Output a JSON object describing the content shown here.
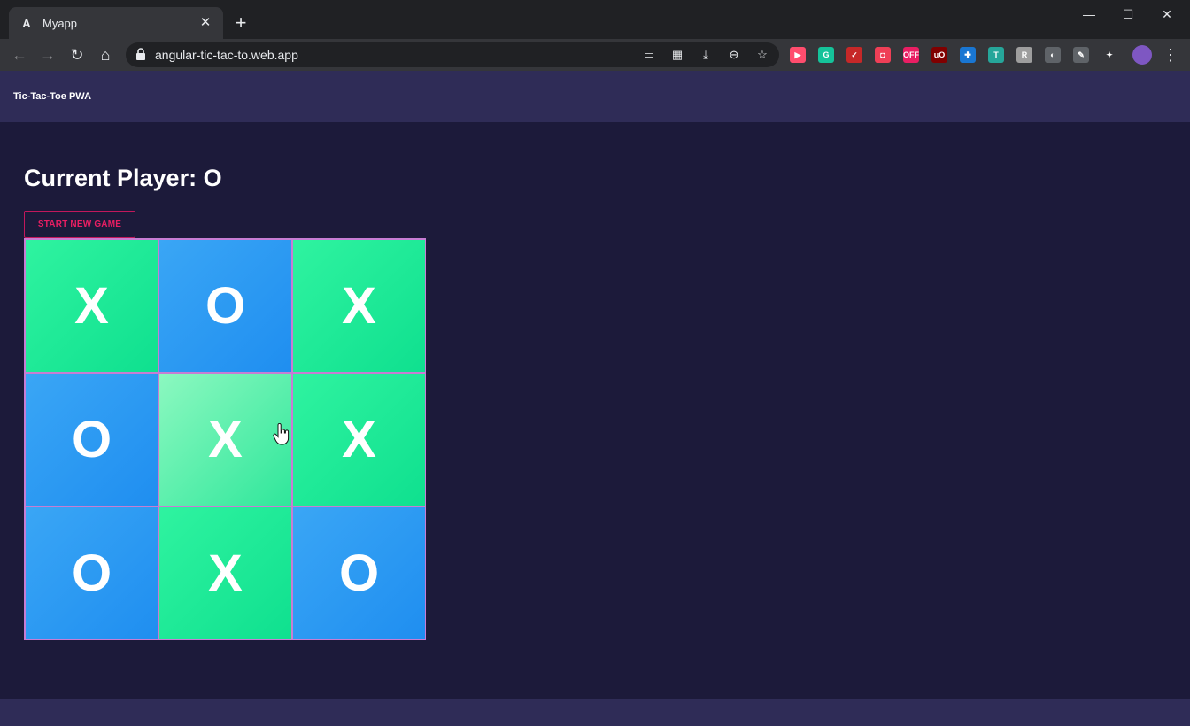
{
  "browser": {
    "tab_title": "Myapp",
    "tab_favicon": "A",
    "url": "angular-tic-tac-to.web.app",
    "extensions": [
      {
        "name": "video-ext-icon",
        "color": "#ff4d6d",
        "glyph": "▶"
      },
      {
        "name": "grammarly-icon",
        "color": "#15c39a",
        "glyph": "G"
      },
      {
        "name": "ext-red-icon",
        "color": "#c62828",
        "glyph": "✓"
      },
      {
        "name": "pocket-icon",
        "color": "#ef3f56",
        "glyph": "◘"
      },
      {
        "name": "off-ext-icon",
        "color": "#e91e63",
        "glyph": "OFF"
      },
      {
        "name": "ublock-icon",
        "color": "#800000",
        "glyph": "uO"
      },
      {
        "name": "blue-ext-icon",
        "color": "#1976d2",
        "glyph": "✚"
      },
      {
        "name": "shirt-ext-icon",
        "color": "#26a69a",
        "glyph": "T"
      },
      {
        "name": "grey-ext-icon",
        "color": "#9e9e9e",
        "glyph": "R"
      },
      {
        "name": "circle-ext-icon",
        "color": "#5f6368",
        "glyph": "◐"
      },
      {
        "name": "pen-ext-icon",
        "color": "#5f6368",
        "glyph": "✎"
      },
      {
        "name": "puzzle-icon",
        "color": "#35363a",
        "glyph": "✦"
      }
    ]
  },
  "app": {
    "title": "Tic-Tac-Toe PWA",
    "current_player_label": "Current Player: O",
    "new_game_label": "START NEW GAME"
  },
  "board": {
    "cells": [
      "X",
      "O",
      "X",
      "O",
      "X",
      "X",
      "O",
      "X",
      "O"
    ],
    "hovered_index": 4
  }
}
